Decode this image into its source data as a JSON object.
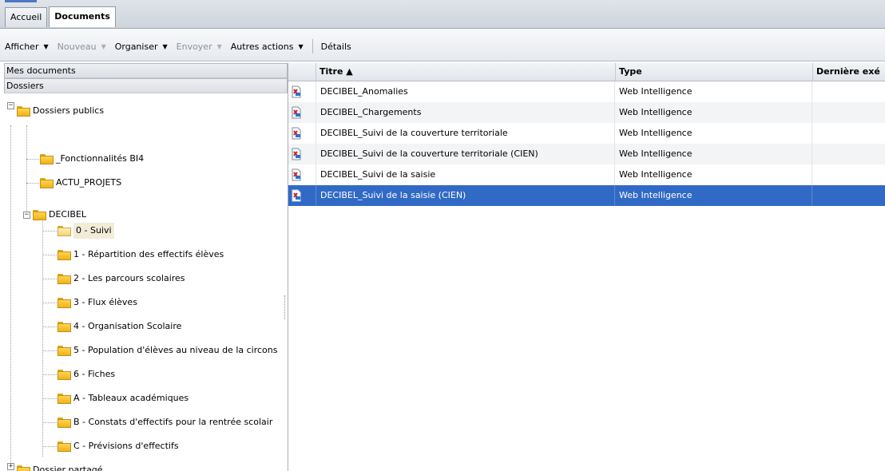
{
  "tabs": [
    {
      "label": "Accueil",
      "active": false
    },
    {
      "label": "Documents",
      "active": true
    }
  ],
  "toolbar": {
    "items": [
      {
        "label": "Afficher",
        "dropdown": true,
        "disabled": false
      },
      {
        "label": "Nouveau",
        "dropdown": true,
        "disabled": true
      },
      {
        "label": "Organiser",
        "dropdown": true,
        "disabled": false
      },
      {
        "label": "Envoyer",
        "dropdown": true,
        "disabled": true
      },
      {
        "label": "Autres actions",
        "dropdown": true,
        "disabled": false
      }
    ],
    "details_label": "Détails"
  },
  "left_panel": {
    "my_documents_label": "Mes documents",
    "folders_label": "Dossiers",
    "tree": [
      {
        "label": "Dossiers publics",
        "level": 0,
        "expander": "−"
      },
      {
        "label": "_Fonctionnalités BI4",
        "level": 1
      },
      {
        "label": "ACTU_PROJETS",
        "level": 1
      },
      {
        "label": "DECIBEL",
        "level": 1,
        "expander": "−"
      },
      {
        "label": "0 - Suivi",
        "level": 2,
        "selected": true,
        "open": true
      },
      {
        "label": "1 - Répartition des effectifs élèves",
        "level": 2
      },
      {
        "label": "2 - Les parcours scolaires",
        "level": 2
      },
      {
        "label": "3 - Flux élèves",
        "level": 2
      },
      {
        "label": "4 - Organisation Scolaire",
        "level": 2
      },
      {
        "label": "5 - Population d'élèves au niveau de la circons",
        "level": 2
      },
      {
        "label": "6 - Fiches",
        "level": 2
      },
      {
        "label": "A - Tableaux académiques",
        "level": 2
      },
      {
        "label": "B - Constats d'effectifs pour la rentrée scolair",
        "level": 2
      },
      {
        "label": "C - Prévisions d'effectifs",
        "level": 2
      },
      {
        "label": "Dossier partagé",
        "level": 0,
        "expander": "+"
      }
    ]
  },
  "list": {
    "columns": [
      "Titre ▲",
      "Type",
      "Dernière exé"
    ],
    "rows": [
      {
        "title": "DECIBEL_Anomalies",
        "type": "Web Intelligence",
        "last_run": ""
      },
      {
        "title": "DECIBEL_Chargements",
        "type": "Web Intelligence",
        "last_run": ""
      },
      {
        "title": "DECIBEL_Suivi de la couverture territoriale",
        "type": "Web Intelligence",
        "last_run": ""
      },
      {
        "title": "DECIBEL_Suivi de la couverture territoriale (CIEN)",
        "type": "Web Intelligence",
        "last_run": ""
      },
      {
        "title": "DECIBEL_Suivi de la saisie",
        "type": "Web Intelligence",
        "last_run": ""
      },
      {
        "title": "DECIBEL_Suivi de la saisie (CIEN)",
        "type": "Web Intelligence",
        "last_run": "",
        "selected": true
      }
    ]
  },
  "icons": {
    "folder": "folder-icon",
    "document": "webi-document-icon",
    "tree_expander": "tree-expander-icon",
    "dropdown": "chevron-down-icon"
  },
  "colors": {
    "selection": "#316ac5",
    "folder": "#f0b21a",
    "toolbar_bg": "#e6e9ee"
  }
}
